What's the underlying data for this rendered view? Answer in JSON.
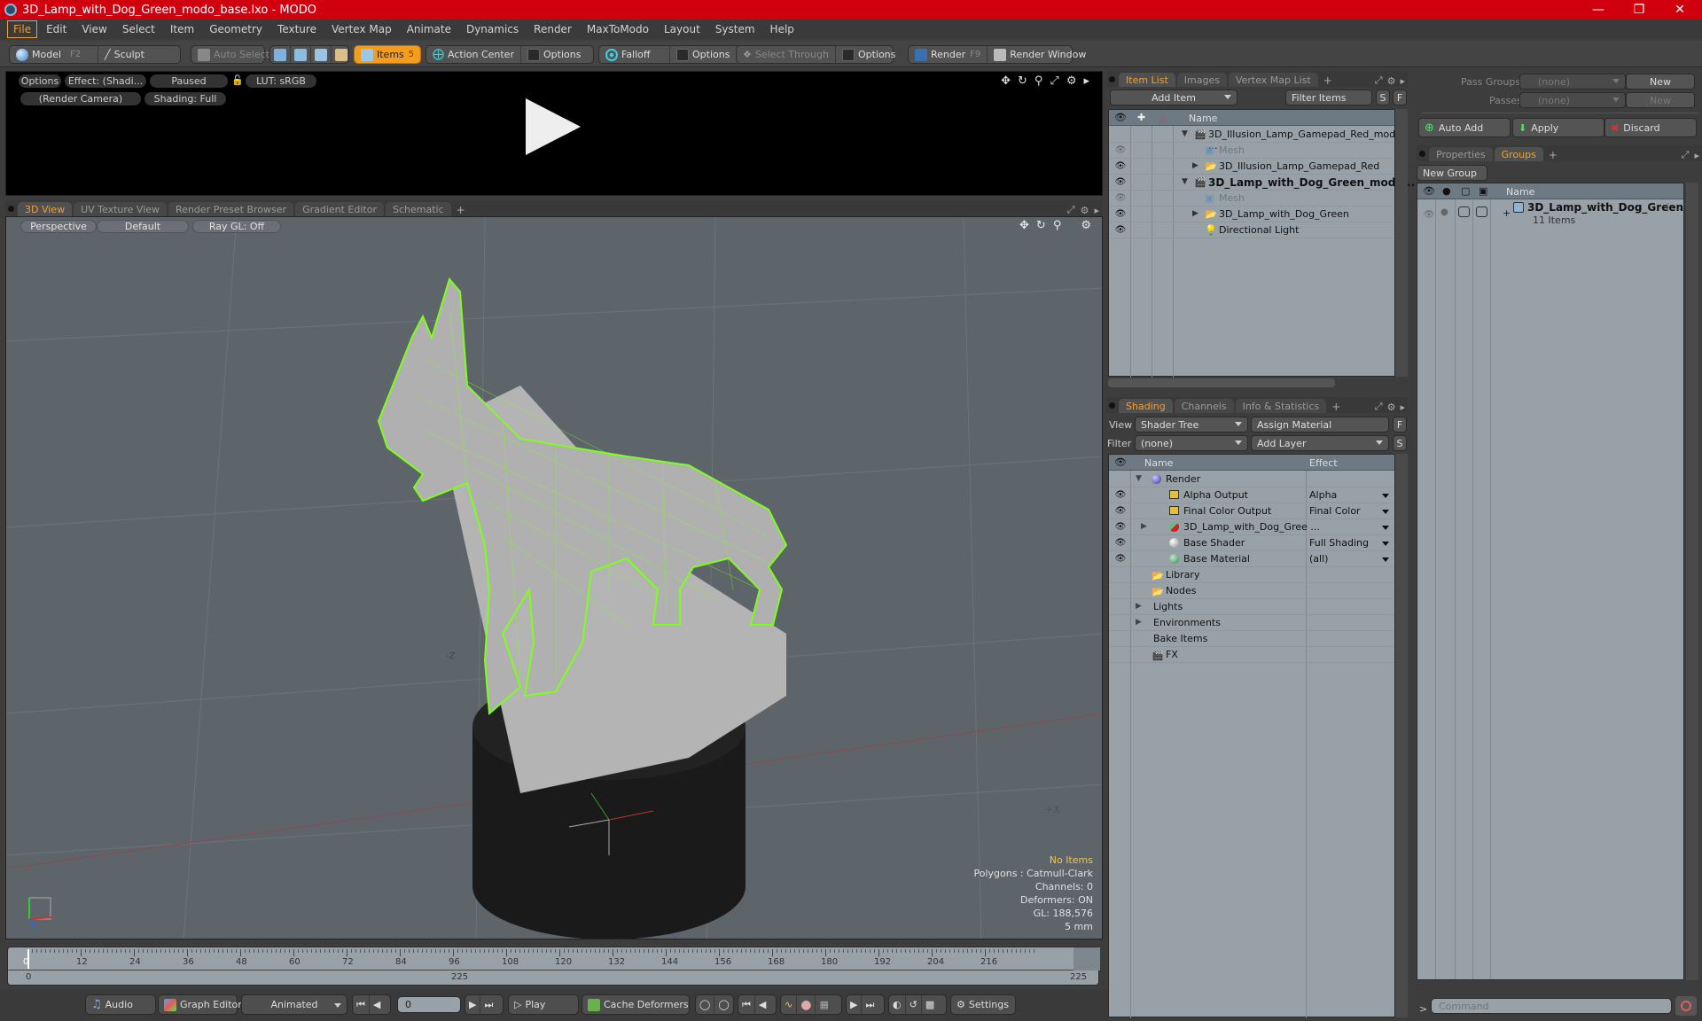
{
  "window": {
    "title": "3D_Lamp_with_Dog_Green_modo_base.lxo - MODO",
    "controls": [
      "minimize",
      "restore",
      "close"
    ]
  },
  "menu": [
    "File",
    "Edit",
    "View",
    "Select",
    "Item",
    "Geometry",
    "Texture",
    "Vertex Map",
    "Animate",
    "Dynamics",
    "Render",
    "MaxToModo",
    "Layout",
    "System",
    "Help"
  ],
  "toolbar": {
    "model": "Model",
    "model_key": "F2",
    "sculpt": "Sculpt",
    "auto_select": "Auto Select",
    "items": "Items",
    "items_count": "5",
    "action_center": "Action Center",
    "options1": "Options",
    "falloff": "Falloff",
    "options2": "Options",
    "select_through": "Select Through",
    "options3": "Options",
    "render": "Render",
    "render_key": "F9",
    "render_window": "Render Window"
  },
  "preview": {
    "options": "Options",
    "effect": "Effect: (Shadi...",
    "status": "Paused",
    "lut": "LUT: sRGB",
    "camera": "(Render Camera)",
    "shading": "Shading: Full"
  },
  "view_tabs": [
    "3D View",
    "UV Texture View",
    "Render Preset Browser",
    "Gradient Editor",
    "Schematic"
  ],
  "viewport": {
    "projection": "Perspective",
    "style": "Default",
    "raygl": "Ray GL: Off",
    "axis_label_neg_z": "-Z",
    "axis_label_pos_x": "+X",
    "stats": {
      "selection": "No Items",
      "polygons": "Polygons : Catmull-Clark",
      "channels": "Channels: 0",
      "deformers": "Deformers: ON",
      "gl": "GL: 188,576",
      "grid": "5 mm"
    }
  },
  "item_list": {
    "tabs": [
      "Item List",
      "Images",
      "Vertex Map List"
    ],
    "add_item": "Add Item",
    "filter": "Filter Items",
    "s": "S",
    "f": "F",
    "col_name": "Name",
    "rows": [
      {
        "name": "3D_Illusion_Lamp_Gamepad_Red_modo ...",
        "indent": 0,
        "type": "scene",
        "expander": "down",
        "eye": false,
        "bold": false,
        "dim": false
      },
      {
        "name": "Mesh",
        "indent": 1,
        "type": "mesh",
        "expander": "",
        "eye": true,
        "bold": false,
        "dim": true
      },
      {
        "name": "3D_Illusion_Lamp_Gamepad_Red",
        "indent": 1,
        "type": "group",
        "expander": "right",
        "eye": true,
        "bold": false,
        "dim": false
      },
      {
        "name": "3D_Lamp_with_Dog_Green_modo...",
        "indent": 0,
        "type": "scene",
        "expander": "down",
        "eye": true,
        "bold": true,
        "dim": false
      },
      {
        "name": "Mesh",
        "indent": 1,
        "type": "mesh",
        "expander": "",
        "eye": true,
        "bold": false,
        "dim": true
      },
      {
        "name": "3D_Lamp_with_Dog_Green",
        "indent": 1,
        "type": "group",
        "expander": "right",
        "eye": true,
        "bold": false,
        "dim": false
      },
      {
        "name": "Directional Light",
        "indent": 1,
        "type": "light",
        "expander": "",
        "eye": true,
        "bold": false,
        "dim": false
      }
    ]
  },
  "shading": {
    "tabs": [
      "Shading",
      "Channels",
      "Info & Statistics"
    ],
    "view_label": "View",
    "view_value": "Shader Tree",
    "assign_material": "Assign Material",
    "f": "F",
    "filter_label": "Filter",
    "filter_value": "(none)",
    "add_layer": "Add Layer",
    "s": "S",
    "col_name": "Name",
    "col_effect": "Effect",
    "rows": [
      {
        "name": "Render",
        "effect": "",
        "eye": false,
        "icon": "render-sphere",
        "indent": 0,
        "expander": "down"
      },
      {
        "name": "Alpha Output",
        "effect": "Alpha",
        "eye": true,
        "icon": "output",
        "indent": 1,
        "expander": ""
      },
      {
        "name": "Final Color Output",
        "effect": "Final Color",
        "eye": true,
        "icon": "output",
        "indent": 1,
        "expander": ""
      },
      {
        "name": "3D_Lamp_with_Dog_Gree ...",
        "effect": "",
        "eye": true,
        "icon": "material-group",
        "indent": 1,
        "expander": "right"
      },
      {
        "name": "Base Shader",
        "effect": "Full Shading",
        "eye": true,
        "icon": "shader",
        "indent": 1,
        "expander": ""
      },
      {
        "name": "Base Material",
        "effect": "(all)",
        "eye": true,
        "icon": "material",
        "indent": 1,
        "expander": ""
      },
      {
        "name": "Library",
        "effect": "",
        "eye": false,
        "icon": "folder",
        "indent": 1,
        "expander": ""
      },
      {
        "name": "Nodes",
        "effect": "",
        "eye": false,
        "icon": "folder",
        "indent": 1,
        "expander": ""
      },
      {
        "name": "Lights",
        "effect": "",
        "eye": false,
        "icon": "",
        "indent": 0,
        "expander": "right"
      },
      {
        "name": "Environments",
        "effect": "",
        "eye": false,
        "icon": "",
        "indent": 0,
        "expander": "right"
      },
      {
        "name": "Bake Items",
        "effect": "",
        "eye": false,
        "icon": "",
        "indent": 0,
        "expander": ""
      },
      {
        "name": "FX",
        "effect": "",
        "eye": false,
        "icon": "fx",
        "indent": 1,
        "expander": ""
      }
    ]
  },
  "passes": {
    "pass_groups_label": "Pass Groups",
    "pass_groups_value": "(none)",
    "new1": "New",
    "passes_label": "Passes",
    "passes_value": "(none)",
    "new2": "New",
    "auto_add": "Auto Add",
    "apply": "Apply",
    "discard": "Discard"
  },
  "groups": {
    "tabs": [
      "Properties",
      "Groups"
    ],
    "new_group": "New Group",
    "col_name": "Name",
    "rows": [
      {
        "name": "3D_Lamp_with_Dog_Green",
        "suffix": "( ...",
        "count": "11 Items"
      }
    ]
  },
  "timeline": {
    "ticks": [
      "0",
      "12",
      "24",
      "36",
      "48",
      "60",
      "72",
      "84",
      "96",
      "108",
      "120",
      "132",
      "144",
      "156",
      "168",
      "180",
      "192",
      "204",
      "216"
    ],
    "range_start": "0",
    "range_end": "225",
    "range_end_mid": "225",
    "current_frame": 0
  },
  "bottombar": {
    "audio": "Audio",
    "graph_editor": "Graph Editor",
    "animated": "Animated",
    "frame": "0",
    "play": "Play",
    "cache_deformers": "Cache Deformers",
    "settings": "Settings"
  },
  "command": {
    "placeholder": "Command",
    "prompt": ">"
  }
}
